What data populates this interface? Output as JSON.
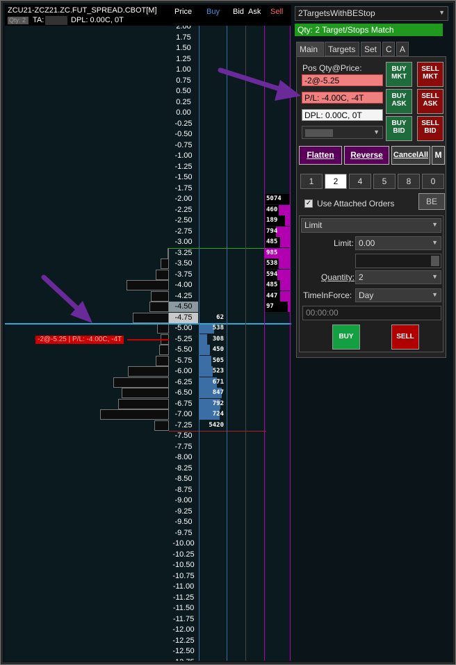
{
  "ladder": {
    "header": {
      "symbol": "ZCU21-ZCZ21.ZC.FUT_SPREAD.CBOT[M]",
      "qty_label": "Qty: 2",
      "ta_label": "TA:",
      "dpl": "DPL: 0.00C, 0T"
    },
    "columns": {
      "price": "Price",
      "buy": "Buy",
      "bid": "Bid",
      "ask": "Ask",
      "sell": "Sell"
    },
    "prices": [
      "2.00",
      "1.75",
      "1.50",
      "1.25",
      "1.00",
      "0.75",
      "0.50",
      "0.25",
      "0.00",
      "-0.25",
      "-0.50",
      "-0.75",
      "-1.00",
      "-1.25",
      "-1.50",
      "-1.75",
      "-2.00",
      "-2.25",
      "-2.50",
      "-2.75",
      "-3.00",
      "-3.25",
      "-3.50",
      "-3.75",
      "-4.00",
      "-4.25",
      "-4.50",
      "-4.75",
      "-5.00",
      "-5.25",
      "-5.50",
      "-5.75",
      "-6.00",
      "-6.25",
      "-6.50",
      "-6.75",
      "-7.00",
      "-7.25",
      "-7.50",
      "-7.75",
      "-8.00",
      "-8.25",
      "-8.50",
      "-8.75",
      "-9.00",
      "-9.25",
      "-9.50",
      "-9.75",
      "-10.00",
      "-10.25",
      "-10.50",
      "-10.75",
      "-11.00",
      "-11.25",
      "-11.50",
      "-11.75",
      "-12.00",
      "-12.25",
      "-12.50",
      "-12.75"
    ],
    "sell_rows": [
      {
        "price": "-2.00",
        "qty": "5074",
        "fill": 0.0
      },
      {
        "price": "-2.25",
        "qty": "460",
        "fill": 0.45
      },
      {
        "price": "-2.50",
        "qty": "189",
        "fill": 0.2
      },
      {
        "price": "-2.75",
        "qty": "794",
        "fill": 0.55
      },
      {
        "price": "-3.00",
        "qty": "485",
        "fill": 0.4
      },
      {
        "price": "-3.25",
        "qty": "985",
        "fill": 1.0
      },
      {
        "price": "-3.50",
        "qty": "538",
        "fill": 0.45
      },
      {
        "price": "-3.75",
        "qty": "594",
        "fill": 0.5
      },
      {
        "price": "-4.00",
        "qty": "485",
        "fill": 0.4
      },
      {
        "price": "-4.25",
        "qty": "447",
        "fill": 0.38
      },
      {
        "price": "-4.50",
        "qty": "97",
        "fill": 0.08
      }
    ],
    "buy_rows": [
      {
        "price": "-4.75",
        "qty": "62",
        "fill": 0.0
      },
      {
        "price": "-5.00",
        "qty": "538",
        "fill": 0.55
      },
      {
        "price": "-5.25",
        "qty": "308",
        "fill": 0.3
      },
      {
        "price": "-5.50",
        "qty": "450",
        "fill": 0.4
      },
      {
        "price": "-5.75",
        "qty": "505",
        "fill": 0.45
      },
      {
        "price": "-6.00",
        "qty": "523",
        "fill": 0.5
      },
      {
        "price": "-6.25",
        "qty": "671",
        "fill": 0.65
      },
      {
        "price": "-6.50",
        "qty": "847",
        "fill": 0.85
      },
      {
        "price": "-6.75",
        "qty": "792",
        "fill": 0.8
      },
      {
        "price": "-7.00",
        "qty": "724",
        "fill": 0.75
      },
      {
        "price": "-7.25",
        "qty": "5420",
        "fill": 0.0
      }
    ],
    "volume_rows": [
      {
        "price": "-3.25",
        "fill": 0.01
      },
      {
        "price": "-3.50",
        "fill": 0.05
      },
      {
        "price": "-3.75",
        "fill": 0.08
      },
      {
        "price": "-4.00",
        "fill": 0.26
      },
      {
        "price": "-4.25",
        "fill": 0.11
      },
      {
        "price": "-4.50",
        "fill": 0.12
      },
      {
        "price": "-4.75",
        "fill": 0.22
      },
      {
        "price": "-5.00",
        "fill": 0.07
      },
      {
        "price": "-5.25",
        "fill": 0.05
      },
      {
        "price": "-5.50",
        "fill": 0.06
      },
      {
        "price": "-5.75",
        "fill": 0.08
      },
      {
        "price": "-6.00",
        "fill": 0.25
      },
      {
        "price": "-6.25",
        "fill": 0.34
      },
      {
        "price": "-6.50",
        "fill": 0.29
      },
      {
        "price": "-6.75",
        "fill": 0.31
      },
      {
        "price": "-7.00",
        "fill": 0.42
      },
      {
        "price": "-7.25",
        "fill": 0.09
      }
    ],
    "position_marker": "-2@-5.25 | P/L: -4.00C, -4T",
    "highlight_prices": [
      "-4.50",
      "-4.75"
    ],
    "last_price_line": "-4.75",
    "green_line_price": "-3.00"
  },
  "panel": {
    "strategy": "2TargetsWithBEStop",
    "status": "Qty: 2 Target/Stops Match",
    "tabs": [
      "Main",
      "Targets",
      "Set",
      "C",
      "A"
    ],
    "pos_label": "Pos Qty@Price:",
    "pos_value": "-2@-5.25",
    "pl_value": "P/L: -4.00C, -4T",
    "dpl_value": "DPL: 0.00C, 0T",
    "buttons": {
      "buy_mkt": "BUY\nMKT",
      "sell_mkt": "SELL\nMKT",
      "buy_ask": "BUY\nASK",
      "sell_ask": "SELL\nASK",
      "buy_bid": "BUY\nBID",
      "sell_bid": "SELL\nBID",
      "flatten": "Flatten",
      "reverse": "Reverse",
      "cancel_all": "CancelAll",
      "m": "M",
      "be": "BE",
      "buy": "BUY",
      "sell": "SELL"
    },
    "qty_buttons": [
      "1",
      "2",
      "4",
      "5",
      "8",
      "0"
    ],
    "active_qty": "2",
    "use_attached_orders": "Use Attached Orders",
    "order_type": "Limit",
    "limit_label": "Limit:",
    "limit_value": "0.00",
    "quantity_label": "Quantity:",
    "quantity_value": "2",
    "tif_label": "TimeInForce:",
    "tif_value": "Day",
    "time_value": "00:00:00"
  },
  "colors": {
    "accent_green": "#1f9a1f",
    "buy_blue": "#3a6ea5",
    "sell_magenta": "#b000b0",
    "arrow_purple": "#6a2a9a"
  }
}
